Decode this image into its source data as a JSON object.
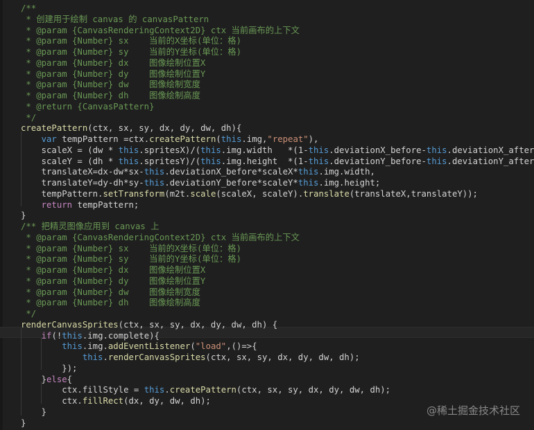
{
  "colors": {
    "background": "#1f1f1f",
    "comment": "#6a9955",
    "keyword": "#c586c0",
    "this": "#569cd6",
    "function": "#dcdcaa",
    "string": "#ce9178",
    "text": "#d4d4d4",
    "identifier": "#9cdcfe",
    "type": "#4ec9b0"
  },
  "watermark": "@稀土掘金技术社区",
  "lines": [
    [
      [
        "/**",
        "comment"
      ]
    ],
    [
      [
        " * 创建用于绘制 canvas 的 canvasPattern",
        "comment"
      ]
    ],
    [
      [
        " * @param {CanvasRenderingContext2D} ctx 当前画布的上下文",
        "comment"
      ]
    ],
    [
      [
        " * @param {Number} sx    当前的X坐标(单位：格)",
        "comment"
      ]
    ],
    [
      [
        " * @param {Number} sy    当前的Y坐标(单位：格)",
        "comment"
      ]
    ],
    [
      [
        " * @param {Number} dx    图像绘制位置X",
        "comment"
      ]
    ],
    [
      [
        " * @param {Number} dy    图像绘制位置Y",
        "comment"
      ]
    ],
    [
      [
        " * @param {Number} dw    图像绘制宽度",
        "comment"
      ]
    ],
    [
      [
        " * @param {Number} dh    图像绘制高度",
        "comment"
      ]
    ],
    [
      [
        " * @return {CanvasPattern}",
        "comment"
      ]
    ],
    [
      [
        " */",
        "comment"
      ]
    ],
    [
      [
        "createPattern",
        "function"
      ],
      [
        "(ctx, sx, sy, dx, dy, dw, dh){",
        "text"
      ]
    ],
    [
      [
        "    ",
        "text"
      ],
      [
        "var",
        "this"
      ],
      [
        " tempPattern =ctx.",
        "text"
      ],
      [
        "createPattern",
        "function"
      ],
      [
        "(",
        "text"
      ],
      [
        "this",
        "this"
      ],
      [
        ".img,",
        "text"
      ],
      [
        "\"repeat\"",
        "string"
      ],
      [
        "),",
        "text"
      ]
    ],
    [
      [
        "    scaleX = (dw * ",
        "text"
      ],
      [
        "this",
        "this"
      ],
      [
        ".spritesX)/(",
        "text"
      ],
      [
        "this",
        "this"
      ],
      [
        ".img.width   *(1-",
        "text"
      ],
      [
        "this",
        "this"
      ],
      [
        ".deviationX_before-",
        "text"
      ],
      [
        "this",
        "this"
      ],
      [
        ".deviationX_after)),",
        "text"
      ]
    ],
    [
      [
        "    scaleY = (dh * ",
        "text"
      ],
      [
        "this",
        "this"
      ],
      [
        ".spritesY)/(",
        "text"
      ],
      [
        "this",
        "this"
      ],
      [
        ".img.height  *(1-",
        "text"
      ],
      [
        "this",
        "this"
      ],
      [
        ".deviationY_before-",
        "text"
      ],
      [
        "this",
        "this"
      ],
      [
        ".deviationY_after)),",
        "text"
      ]
    ],
    [
      [
        "    translateX=dx-dw*sx-",
        "text"
      ],
      [
        "this",
        "this"
      ],
      [
        ".deviationX_before*scaleX*",
        "text"
      ],
      [
        "this",
        "this"
      ],
      [
        ".img.width,",
        "text"
      ]
    ],
    [
      [
        "    translateY=dy-dh*sy-",
        "text"
      ],
      [
        "this",
        "this"
      ],
      [
        ".deviationY_before*scaleY*",
        "text"
      ],
      [
        "this",
        "this"
      ],
      [
        ".img.height;",
        "text"
      ]
    ],
    [
      [
        "    tempPattern.",
        "text"
      ],
      [
        "setTransform",
        "function"
      ],
      [
        "(m2t.",
        "text"
      ],
      [
        "scale",
        "function"
      ],
      [
        "(scaleX, scaleY).",
        "text"
      ],
      [
        "translate",
        "function"
      ],
      [
        "(translateX,translateY));",
        "text"
      ]
    ],
    [
      [
        "    ",
        "text"
      ],
      [
        "return",
        "keyword"
      ],
      [
        " tempPattern;",
        "text"
      ]
    ],
    [
      [
        "}",
        "text"
      ]
    ],
    [
      [
        "/** 把精灵图像应用到 canvas 上",
        "comment"
      ]
    ],
    [
      [
        " * @param {CanvasRenderingContext2D} ctx 当前画布的上下文",
        "comment"
      ]
    ],
    [
      [
        " * @param {Number} sx    当前的X坐标(单位：格)",
        "comment"
      ]
    ],
    [
      [
        " * @param {Number} sy    当前的Y坐标(单位：格)",
        "comment"
      ]
    ],
    [
      [
        " * @param {Number} dx    图像绘制位置X",
        "comment"
      ]
    ],
    [
      [
        " * @param {Number} dy    图像绘制位置Y",
        "comment"
      ]
    ],
    [
      [
        " * @param {Number} dw    图像绘制宽度",
        "comment"
      ]
    ],
    [
      [
        " * @param {Number} dh    图像绘制高度",
        "comment"
      ]
    ],
    [
      [
        " */",
        "comment"
      ]
    ],
    [
      [
        "renderCanvasSprites",
        "function"
      ],
      [
        "(ctx, sx, sy, dx, dy, dw, dh) {",
        "text"
      ]
    ],
    [
      [
        "    ",
        "text"
      ],
      [
        "if",
        "keyword"
      ],
      [
        "(!",
        "text"
      ],
      [
        "this",
        "this"
      ],
      [
        ".img.complete){",
        "text"
      ]
    ],
    [
      [
        "        ",
        "text"
      ],
      [
        "this",
        "this"
      ],
      [
        ".img.",
        "text"
      ],
      [
        "addEventListener",
        "function"
      ],
      [
        "(",
        "text"
      ],
      [
        "\"load\"",
        "string"
      ],
      [
        ",()=>{",
        "text"
      ]
    ],
    [
      [
        "            ",
        "text"
      ],
      [
        "this",
        "this"
      ],
      [
        ".",
        "text"
      ],
      [
        "renderCanvasSprites",
        "function"
      ],
      [
        "(ctx, sx, sy, dx, dy, dw, dh);",
        "text"
      ]
    ],
    [
      [
        "        });",
        "text"
      ]
    ],
    [
      [
        "    }",
        "text"
      ],
      [
        "else",
        "keyword"
      ],
      [
        "{",
        "text"
      ]
    ],
    [
      [
        "        ctx.fillStyle = ",
        "text"
      ],
      [
        "this",
        "this"
      ],
      [
        ".",
        "text"
      ],
      [
        "createPattern",
        "function"
      ],
      [
        "(ctx, sx, sy, dx, dy, dw, dh);",
        "text"
      ]
    ],
    [
      [
        "        ctx.",
        "text"
      ],
      [
        "fillRect",
        "function"
      ],
      [
        "(dx, dy, dw, dh);",
        "text"
      ]
    ],
    [
      [
        "    }",
        "text"
      ]
    ],
    [
      [
        "}",
        "text"
      ]
    ]
  ]
}
